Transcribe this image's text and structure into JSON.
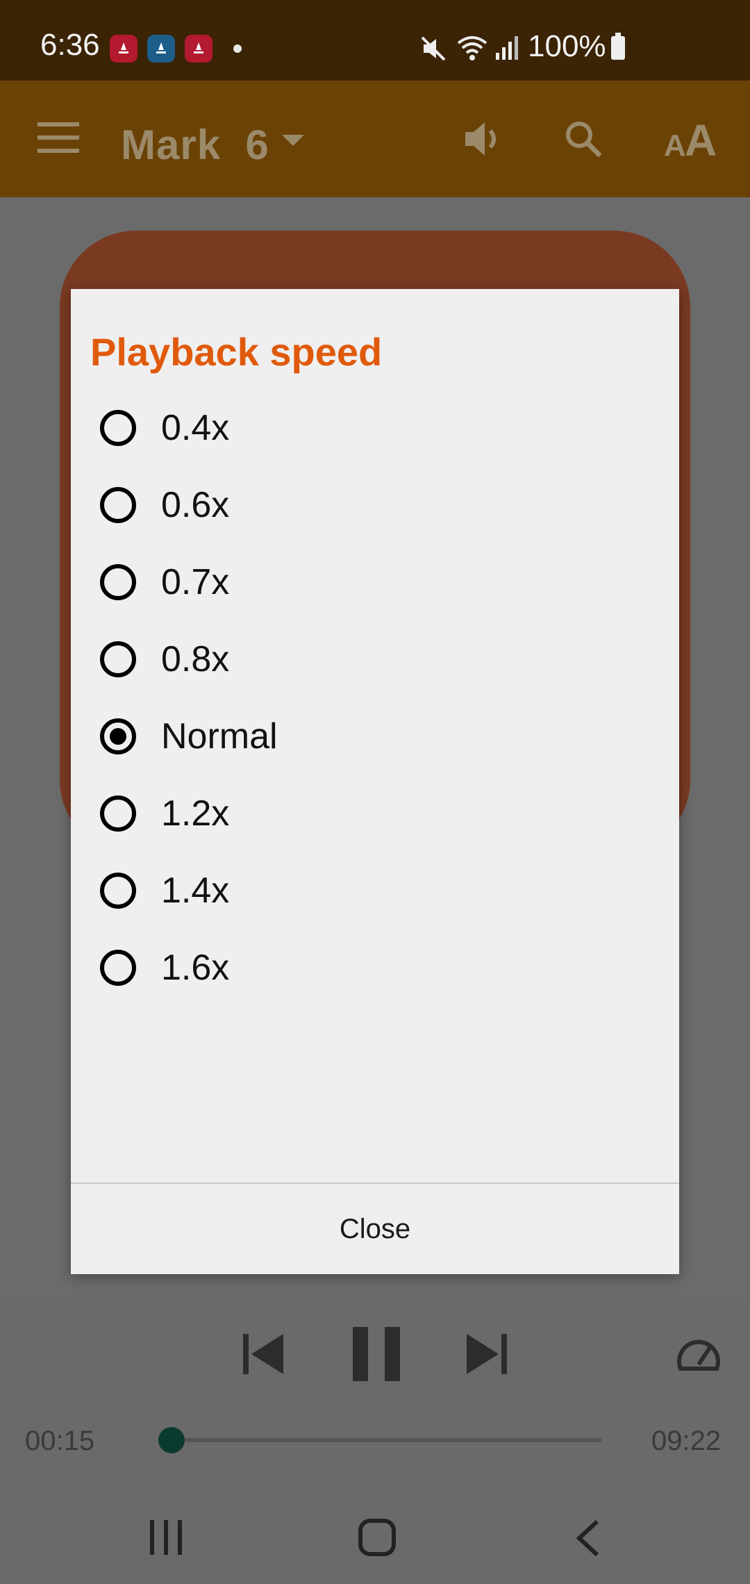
{
  "status_bar": {
    "time": "6:36",
    "battery_percent": "100%",
    "icons": [
      "app-icon-1",
      "app-icon-2",
      "app-icon-3",
      "notification-dot-icon",
      "mute-icon",
      "wifi-icon",
      "signal-icon",
      "battery-icon"
    ]
  },
  "app_bar": {
    "title": "Mark  6",
    "icons": [
      "menu-icon",
      "dropdown-caret-icon",
      "speaker-icon",
      "search-icon",
      "text-size-icon"
    ]
  },
  "dialog": {
    "title": "Playback speed",
    "options": [
      {
        "label": "0.4x",
        "selected": false
      },
      {
        "label": "0.6x",
        "selected": false
      },
      {
        "label": "0.7x",
        "selected": false
      },
      {
        "label": "0.8x",
        "selected": false
      },
      {
        "label": "Normal",
        "selected": true
      },
      {
        "label": "1.2x",
        "selected": false
      },
      {
        "label": "1.4x",
        "selected": false
      },
      {
        "label": "1.6x",
        "selected": false
      }
    ],
    "close_label": "Close"
  },
  "player": {
    "elapsed": "00:15",
    "total": "09:22",
    "progress_fraction": 0.027,
    "icons": [
      "skip-previous-icon",
      "pause-icon",
      "skip-next-icon",
      "speed-gauge-icon"
    ]
  },
  "nav_bar": {
    "icons": [
      "recent-apps-icon",
      "home-icon",
      "back-icon"
    ]
  },
  "colors": {
    "status_bar_bg": "#3b2306",
    "app_bar_bg": "#6b4206",
    "dialog_title": "#e05a0c",
    "dim_overlay": "#6b6b6b"
  }
}
